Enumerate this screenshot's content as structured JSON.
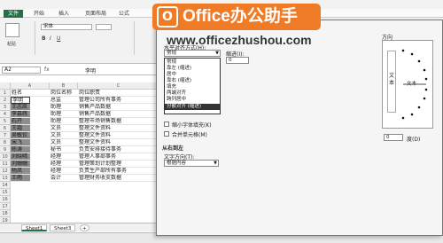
{
  "ribbon": {
    "file_tab": "文件",
    "tabs": [
      "开始",
      "插入",
      "页面布局",
      "公式"
    ],
    "font_name": "宋体",
    "clipboard_label": "粘贴",
    "bold": "B",
    "italic": "I",
    "underline": "U"
  },
  "formula_bar": {
    "name_box": "A2",
    "fx": "fx",
    "value": "李明"
  },
  "grid": {
    "columns": [
      "A",
      "B",
      "C"
    ],
    "header_row": [
      "姓名",
      "岗位名称",
      "岗位职责"
    ],
    "rows": [
      {
        "n": "2",
        "a": "李明",
        "b": "总监",
        "c": "管理公司所有事务"
      },
      {
        "n": "3",
        "a": "王志凯",
        "b": "助理",
        "c": "销售产品数据"
      },
      {
        "n": "4",
        "a": "李慕辉",
        "b": "助理",
        "c": "销售产品数据"
      },
      {
        "n": "5",
        "a": "石开",
        "b": "助理",
        "c": "整理市场销售数据"
      },
      {
        "n": "6",
        "a": "王霜",
        "b": "文员",
        "c": "整理文件资料"
      },
      {
        "n": "7",
        "a": "吴敏钦",
        "b": "文员",
        "c": "整理文件资料"
      },
      {
        "n": "8",
        "a": "宋飞",
        "b": "文员",
        "c": "整理文件资料"
      },
      {
        "n": "9",
        "a": "陈涛",
        "b": "秘书",
        "c": "负责安排接待事务"
      },
      {
        "n": "10",
        "a": "刘晓晴",
        "b": "经理",
        "c": "管理人事部事务"
      },
      {
        "n": "11",
        "a": "刘姗姗",
        "b": "经理",
        "c": "管理策划计划整理"
      },
      {
        "n": "12",
        "a": "杨凤",
        "b": "经理",
        "c": "负责生产部所有事务"
      },
      {
        "n": "13",
        "a": "王雨",
        "b": "会计",
        "c": "管理财务收支数据"
      }
    ],
    "extra_row_numbers": [
      "14",
      "15",
      "16",
      "17",
      "18",
      "19",
      "20"
    ]
  },
  "sheets": [
    "Sheet1",
    "Sheet3"
  ],
  "dialog": {
    "h_align_label": "水平对齐方式(H):",
    "h_align_value": "常规",
    "indent_label": "缩进(I):",
    "indent_value": "0",
    "h_align_options": [
      "常规",
      "靠左 (缩进)",
      "居中",
      "靠右 (缩进)",
      "填充",
      "两端对齐",
      "跨列居中",
      "分散对齐 (缩进)"
    ],
    "selected_option": "分散对齐 (缩进)",
    "shrink_label": "缩小字体填充(K)",
    "merge_label": "合并单元格(M)",
    "rtl_section": "从右到左",
    "text_dir_label": "文字方向(T):",
    "text_dir_value": "根据内容",
    "orientation_label": "方向",
    "vertical_text": "文本",
    "orient_text": "文本",
    "degrees_value": "0",
    "degrees_label": "度(D)"
  },
  "watermark": {
    "badge_icon": "O",
    "badge_text": "Office办公助手",
    "url": "www.officezhushou.com"
  },
  "colors": {
    "accent": "#217346",
    "badge": "#f07b27",
    "selection": "#8d8d8d"
  }
}
